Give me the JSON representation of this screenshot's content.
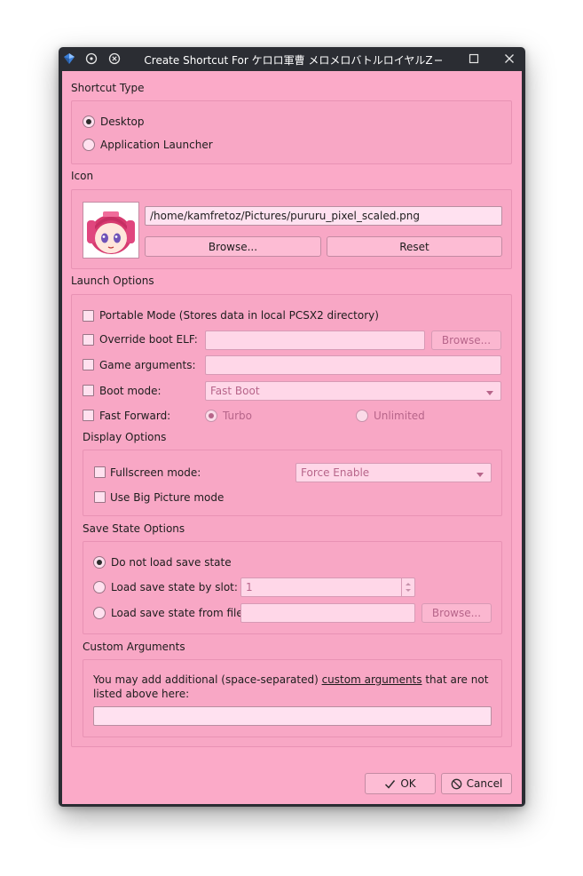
{
  "window": {
    "title": "Create Shortcut For ケロロ軍曹 メロメロバトルロイヤルZ",
    "controls": {
      "minimize": "–",
      "maximize": "☐",
      "close": "✕"
    }
  },
  "shortcut_type": {
    "title": "Shortcut Type",
    "desktop": "Desktop",
    "launcher": "Application Launcher",
    "selected": "Desktop"
  },
  "icon": {
    "title": "Icon",
    "path": "/home/kamfretoz/Pictures/pururu_pixel_scaled.png",
    "browse": "Browse...",
    "reset": "Reset"
  },
  "launch": {
    "title": "Launch Options",
    "portable": "Portable Mode (Stores data in local PCSX2 directory)",
    "override_elf": "Override boot ELF:",
    "elf_value": "",
    "elf_browse": "Browse...",
    "game_args": "Game arguments:",
    "game_args_value": "",
    "boot_mode": "Boot mode:",
    "boot_mode_value": "Fast Boot",
    "fast_forward": "Fast Forward:",
    "turbo": "Turbo",
    "unlimited": "Unlimited"
  },
  "display": {
    "title": "Display Options",
    "fullscreen": "Fullscreen mode:",
    "fullscreen_value": "Force Enable",
    "big_picture": "Use Big Picture mode"
  },
  "save_state": {
    "title": "Save State Options",
    "none": "Do not load save state",
    "slot": "Load save state by slot:",
    "slot_value": "1",
    "file": "Load save state from file:",
    "file_value": "",
    "browse": "Browse..."
  },
  "custom": {
    "title": "Custom Arguments",
    "description_pre": "You may add additional (space-separated) ",
    "link": "custom arguments",
    "description_post": " that are not listed above here:",
    "value": ""
  },
  "footer": {
    "ok": "OK",
    "cancel": "Cancel"
  },
  "colors": {
    "background": "#fbaac8",
    "titlebar": "#2b2d33",
    "field": "#ffe1f0"
  }
}
